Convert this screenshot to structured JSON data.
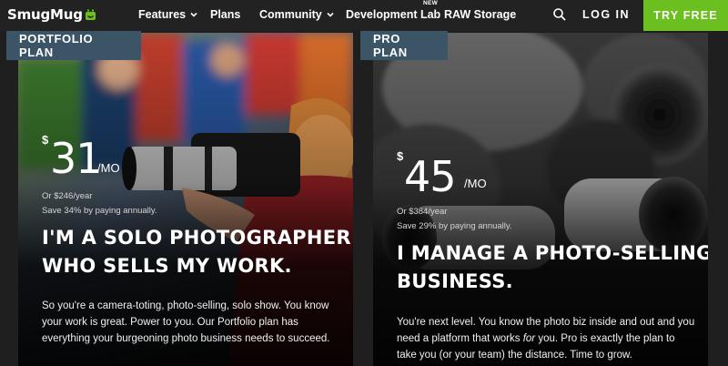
{
  "nav": {
    "logo": "SmugMug",
    "items": [
      {
        "label": "Features",
        "has_dropdown": true
      },
      {
        "label": "Plans",
        "has_dropdown": false
      },
      {
        "label": "Community",
        "has_dropdown": true
      },
      {
        "label": "Development Lab",
        "has_dropdown": false
      },
      {
        "label": "RAW Storage",
        "has_dropdown": false
      }
    ],
    "new_badge": "NEW",
    "search_icon": "search-icon",
    "login_label": "LOG IN",
    "cta_label": "TRY FREE",
    "cta_color": "#6bbf1e"
  },
  "plans": [
    {
      "tab": "PORTFOLIO PLAN",
      "currency": "$",
      "price": "31",
      "period": "/MO",
      "yearly": "Or $246/year",
      "savings": "Save 34% by paying annually.",
      "headline_line1": "I'M A SOLO PHOTOGRAPHER",
      "headline_line2": "WHO SELLS MY WORK.",
      "description": "So you're a camera-toting, photo-selling, solo show. You know your work is great. Power to you. Our Portfolio plan has everything your burgeoning photo business needs to succeed."
    },
    {
      "tab": "PRO PLAN",
      "currency": "$",
      "price": "45",
      "period": "/MO",
      "yearly": "Or $384/year",
      "savings": "Save 29% by paying annually.",
      "headline_line1": "I MANAGE A PHOTO-SELLING",
      "headline_line2": "BUSINESS.",
      "description_part1": "You're next level. You know the photo biz inside and out and you need a platform that works ",
      "description_em": "for",
      "description_part2": " you. Pro is exactly the plan to take you (or your team) the distance. Time to grow."
    }
  ],
  "colors": {
    "tab_bg": "#3b5566",
    "nav_bg": "#222222"
  }
}
